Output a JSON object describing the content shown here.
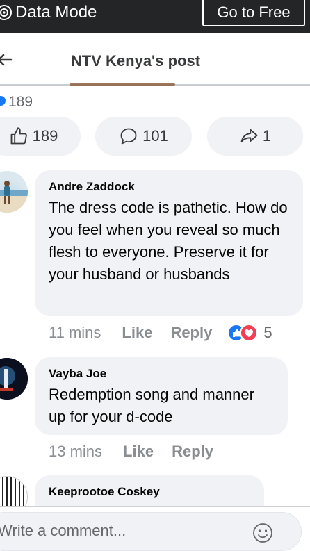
{
  "banner": {
    "label": "Data Mode",
    "cta": "Go to Free"
  },
  "header": {
    "title": "NTV Kenya's post"
  },
  "summary": {
    "reaction_count": "189"
  },
  "actions": {
    "like_count": "189",
    "comment_count": "101",
    "share_count": "1"
  },
  "comments": [
    {
      "author": "Andre Zaddock",
      "text": "The dress code is pathetic. How do you feel when you reveal so much flesh to everyone. Preserve it for your husband or husbands",
      "time": "11 mins",
      "like_label": "Like",
      "reply_label": "Reply",
      "reaction_count": "5"
    },
    {
      "author": "Vayba Joe",
      "text": "Redemption song and manner up for your d-code",
      "time": "13 mins",
      "like_label": "Like",
      "reply_label": "Reply"
    },
    {
      "author": "Keeprootoe Coskey"
    }
  ],
  "composer": {
    "placeholder": "Write a comment..."
  },
  "colors": {
    "brand_blue": "#1877f2",
    "love_red": "#f33e58",
    "banner_bg": "#242526",
    "bubble_bg": "#f0f2f5"
  },
  "icons": [
    "data-mode-icon",
    "back-arrow-icon",
    "thumbs-up-icon",
    "comment-icon",
    "share-icon",
    "like-reaction-icon",
    "love-reaction-icon",
    "emoji-icon"
  ]
}
